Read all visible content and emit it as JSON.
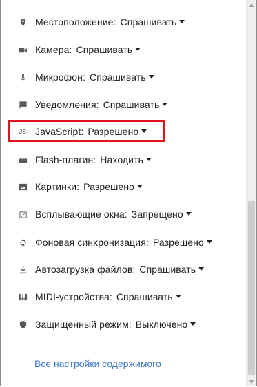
{
  "settings": {
    "items": [
      {
        "icon": "location-pin-icon",
        "label": "Местоположение:",
        "value": "Спрашивать"
      },
      {
        "icon": "camera-icon",
        "label": "Камера:",
        "value": "Спрашивать"
      },
      {
        "icon": "microphone-icon",
        "label": "Микрофон:",
        "value": "Спрашивать"
      },
      {
        "icon": "notification-icon",
        "label": "Уведомления:",
        "value": "Спрашивать"
      },
      {
        "icon": "javascript-icon",
        "icon_text": "JS",
        "label": "JavaScript:",
        "value": "Разрешено"
      },
      {
        "icon": "flash-plugin-icon",
        "label": "Flash-плагин:",
        "value": "Находить"
      },
      {
        "icon": "image-icon",
        "label": "Картинки:",
        "value": "Разрешено"
      },
      {
        "icon": "popup-blocked-icon",
        "label": "Всплывающие окна:",
        "value": "Запрещено"
      },
      {
        "icon": "sync-icon",
        "label": "Фоновая синхронизация:",
        "value": "Разрешено"
      },
      {
        "icon": "download-icon",
        "label": "Автозагрузка файлов:",
        "value": "Спрашивать"
      },
      {
        "icon": "midi-icon",
        "label": "MIDI-устройства:",
        "value": "Спрашивать"
      },
      {
        "icon": "shield-icon",
        "label": "Защищенный режим:",
        "value": "Выключено"
      }
    ]
  },
  "links": {
    "all_content_settings": "Все настройки содержимого"
  },
  "colors": {
    "highlight_border": "#e0141e",
    "link": "#3a76c9",
    "text": "#212121"
  }
}
